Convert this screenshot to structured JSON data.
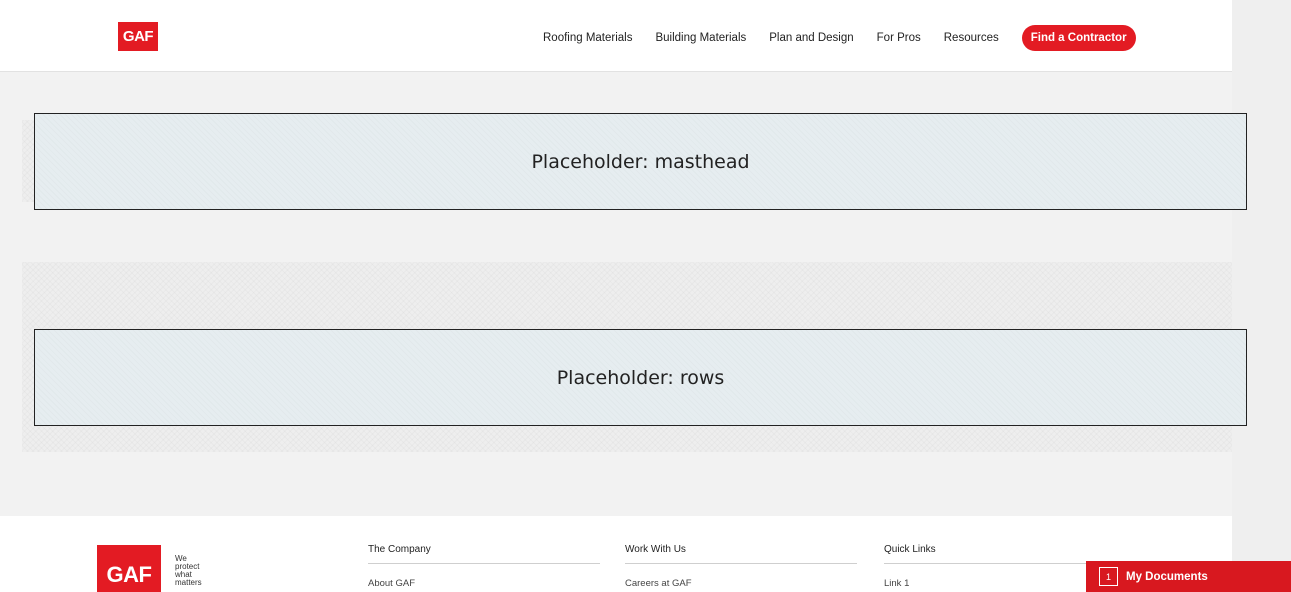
{
  "header": {
    "logo_text": "GAF",
    "nav": [
      {
        "label": "Roofing Materials"
      },
      {
        "label": "Building Materials"
      },
      {
        "label": "Plan and Design"
      },
      {
        "label": "For Pros"
      },
      {
        "label": "Resources"
      }
    ],
    "cta_label": "Find a Contractor"
  },
  "main": {
    "masthead_placeholder": "Placeholder: masthead",
    "rows_placeholder": "Placeholder: rows"
  },
  "footer": {
    "logo_text": "GAF",
    "tagline": [
      "We",
      "protect",
      "what",
      "matters"
    ],
    "columns": [
      {
        "heading": "The Company",
        "links": [
          "About GAF"
        ]
      },
      {
        "heading": "Work With Us",
        "links": [
          "Careers at GAF"
        ]
      },
      {
        "heading": "Quick Links",
        "links": [
          "Link 1"
        ]
      }
    ]
  },
  "my_documents": {
    "count": "1",
    "label": "My Documents"
  },
  "colors": {
    "brand_red": "#e31b23",
    "page_bg": "#f2f2f2",
    "placeholder_bg": "#e6edf0"
  }
}
